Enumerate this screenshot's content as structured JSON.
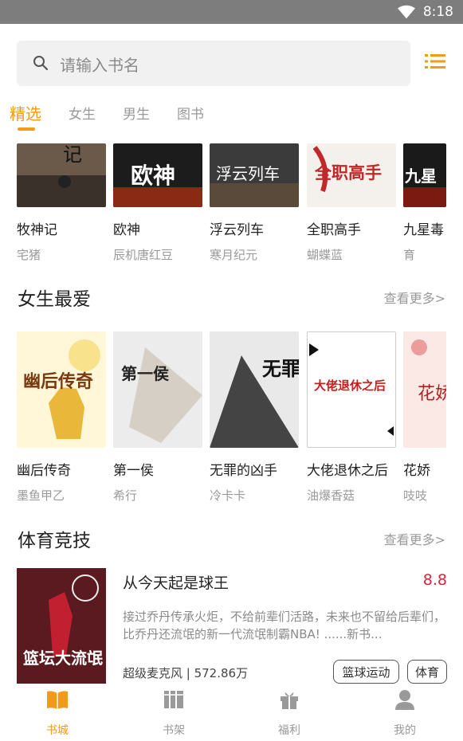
{
  "status": {
    "time": "8:18"
  },
  "search": {
    "placeholder": "请输入书名"
  },
  "tabs": [
    {
      "label": "精选",
      "active": true
    },
    {
      "label": "女生"
    },
    {
      "label": "男生"
    },
    {
      "label": "图书"
    }
  ],
  "top_row": [
    {
      "title": "牧神记",
      "author": "宅猪",
      "cover_text": "记"
    },
    {
      "title": "欧神",
      "author": "辰机唐红豆",
      "cover_text": "欧神"
    },
    {
      "title": "浮云列车",
      "author": "寒月纪元",
      "cover_text": "浮云列车"
    },
    {
      "title": "全职高手",
      "author": "蝴蝶蓝",
      "cover_text": "全职高手"
    },
    {
      "title": "九星毒",
      "author": "育",
      "cover_text": "九星"
    }
  ],
  "section_female": {
    "title": "女生最爱",
    "more": "查看更多>",
    "books": [
      {
        "title": "幽后传奇",
        "author": "墨鱼甲乙",
        "cover_text": "幽后传奇"
      },
      {
        "title": "第一侯",
        "author": "希行",
        "cover_text": "第一侯"
      },
      {
        "title": "无罪的凶手",
        "author": "冷卡卡",
        "cover_text": "无罪"
      },
      {
        "title": "大佬退休之后",
        "author": "油爆香菇",
        "cover_text": "大佬退休之后"
      },
      {
        "title": "花娇",
        "author": "吱吱",
        "cover_text": "花娇"
      }
    ]
  },
  "section_sports": {
    "title": "体育竞技",
    "more": "查看更多>",
    "feature": {
      "title": "从今天起是球王",
      "score": "8.8",
      "desc": "接过乔丹传承火炬，不给前辈们活路，未来也不留给后辈们，比乔丹还流氓的新一代流氓制霸NBA! ......新书...",
      "meta": "超级麦克风 | 572.86万",
      "tags": [
        "篮球运动",
        "体育"
      ],
      "cover_text": "篮坛大流氓"
    }
  },
  "nav": [
    {
      "label": "书城",
      "active": true
    },
    {
      "label": "书架"
    },
    {
      "label": "福利"
    },
    {
      "label": "我的"
    }
  ],
  "colors": {
    "accent": "#f39a1a",
    "score": "#e0203a"
  }
}
